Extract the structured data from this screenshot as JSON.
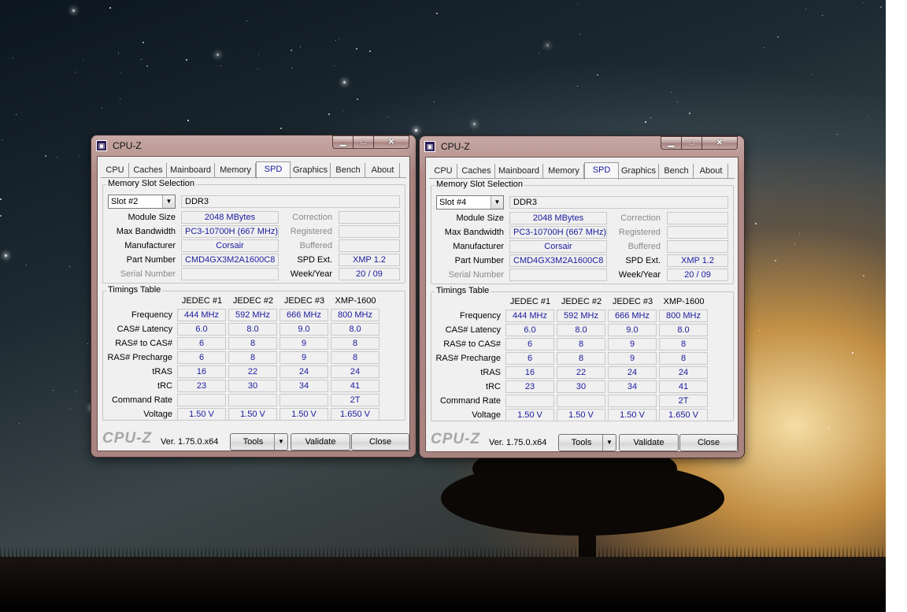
{
  "windows": [
    {
      "title": "CPU-Z",
      "icon": "cpuz-app-icon",
      "tabs": [
        "CPU",
        "Caches",
        "Mainboard",
        "Memory",
        "SPD",
        "Graphics",
        "Bench",
        "About"
      ],
      "active_tab": "SPD",
      "slot_group_title": "Memory Slot Selection",
      "slot": "Slot #2",
      "memory_type": "DDR3",
      "module_size_label": "Module Size",
      "module_size": "2048 MBytes",
      "max_bw_label": "Max Bandwidth",
      "max_bw": "PC3-10700H (667 MHz)",
      "manufacturer_label": "Manufacturer",
      "manufacturer": "Corsair",
      "part_label": "Part Number",
      "part": "CMD4GX3M2A1600C8",
      "serial_label": "Serial Number",
      "serial": "",
      "correction_label": "Correction",
      "correction": "",
      "registered_label": "Registered",
      "registered": "",
      "buffered_label": "Buffered",
      "buffered": "",
      "spd_ext_label": "SPD Ext.",
      "spd_ext": "XMP 1.2",
      "weekyear_label": "Week/Year",
      "weekyear": "20 / 09",
      "timings_title": "Timings Table",
      "timing_columns": [
        "JEDEC #1",
        "JEDEC #2",
        "JEDEC #3",
        "XMP-1600"
      ],
      "timing_rows": [
        {
          "label": "Frequency",
          "values": [
            "444 MHz",
            "592 MHz",
            "666 MHz",
            "800 MHz"
          ]
        },
        {
          "label": "CAS# Latency",
          "values": [
            "6.0",
            "8.0",
            "9.0",
            "8.0"
          ]
        },
        {
          "label": "RAS# to CAS#",
          "values": [
            "6",
            "8",
            "9",
            "8"
          ]
        },
        {
          "label": "RAS# Precharge",
          "values": [
            "6",
            "8",
            "9",
            "8"
          ]
        },
        {
          "label": "tRAS",
          "values": [
            "16",
            "22",
            "24",
            "24"
          ]
        },
        {
          "label": "tRC",
          "values": [
            "23",
            "30",
            "34",
            "41"
          ]
        },
        {
          "label": "Command Rate",
          "values": [
            "",
            "",
            "",
            "2T"
          ]
        },
        {
          "label": "Voltage",
          "values": [
            "1.50 V",
            "1.50 V",
            "1.50 V",
            "1.650 V"
          ]
        }
      ],
      "footer_logo": "CPU-Z",
      "version": "Ver. 1.75.0.x64",
      "tools_label": "Tools",
      "validate_label": "Validate",
      "close_label": "Close"
    },
    {
      "title": "CPU-Z",
      "icon": "cpuz-app-icon",
      "tabs": [
        "CPU",
        "Caches",
        "Mainboard",
        "Memory",
        "SPD",
        "Graphics",
        "Bench",
        "About"
      ],
      "active_tab": "SPD",
      "slot_group_title": "Memory Slot Selection",
      "slot": "Slot #4",
      "memory_type": "DDR3",
      "module_size_label": "Module Size",
      "module_size": "2048 MBytes",
      "max_bw_label": "Max Bandwidth",
      "max_bw": "PC3-10700H (667 MHz)",
      "manufacturer_label": "Manufacturer",
      "manufacturer": "Corsair",
      "part_label": "Part Number",
      "part": "CMD4GX3M2A1600C8",
      "serial_label": "Serial Number",
      "serial": "",
      "correction_label": "Correction",
      "correction": "",
      "registered_label": "Registered",
      "registered": "",
      "buffered_label": "Buffered",
      "buffered": "",
      "spd_ext_label": "SPD Ext.",
      "spd_ext": "XMP 1.2",
      "weekyear_label": "Week/Year",
      "weekyear": "20 / 09",
      "timings_title": "Timings Table",
      "timing_columns": [
        "JEDEC #1",
        "JEDEC #2",
        "JEDEC #3",
        "XMP-1600"
      ],
      "timing_rows": [
        {
          "label": "Frequency",
          "values": [
            "444 MHz",
            "592 MHz",
            "666 MHz",
            "800 MHz"
          ]
        },
        {
          "label": "CAS# Latency",
          "values": [
            "6.0",
            "8.0",
            "9.0",
            "8.0"
          ]
        },
        {
          "label": "RAS# to CAS#",
          "values": [
            "6",
            "8",
            "9",
            "8"
          ]
        },
        {
          "label": "RAS# Precharge",
          "values": [
            "6",
            "8",
            "9",
            "8"
          ]
        },
        {
          "label": "tRAS",
          "values": [
            "16",
            "22",
            "24",
            "24"
          ]
        },
        {
          "label": "tRC",
          "values": [
            "23",
            "30",
            "34",
            "41"
          ]
        },
        {
          "label": "Command Rate",
          "values": [
            "",
            "",
            "",
            "2T"
          ]
        },
        {
          "label": "Voltage",
          "values": [
            "1.50 V",
            "1.50 V",
            "1.50 V",
            "1.650 V"
          ]
        }
      ],
      "footer_logo": "CPU-Z",
      "version": "Ver. 1.75.0.x64",
      "tools_label": "Tools",
      "validate_label": "Validate",
      "close_label": "Close"
    }
  ],
  "window_controls": {
    "minimize_icon": "minimize-icon",
    "maximize_icon": "maximize-icon",
    "close_icon": "close-icon"
  }
}
